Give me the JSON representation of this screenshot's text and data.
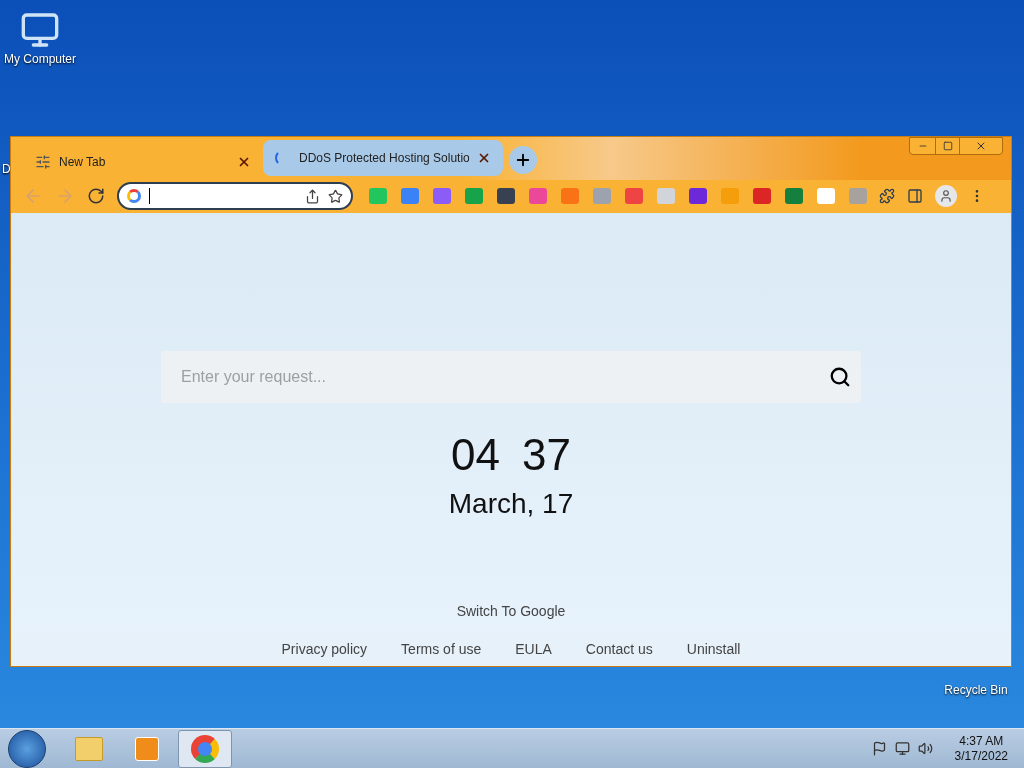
{
  "desktop_icons": [
    {
      "kind": "computer",
      "label": "My Computer"
    },
    {
      "kind": "hidden",
      "label": "D"
    },
    {
      "kind": "bin",
      "label": "Recycle Bin"
    }
  ],
  "tabs": [
    {
      "title": "New Tab",
      "selected": true
    },
    {
      "title": "DDoS Protected Hosting Solutio",
      "selected": false
    }
  ],
  "search": {
    "placeholder": "Enter your request..."
  },
  "clock": {
    "hours": "04",
    "minutes": "37",
    "date": "March, 17"
  },
  "switch_link": "Switch To Google",
  "footer_links": [
    "Privacy policy",
    "Terms of use",
    "EULA",
    "Contact us",
    "Uninstall"
  ],
  "taskbar": {
    "items": [
      {
        "kind": "folder",
        "selected": false
      },
      {
        "kind": "media",
        "selected": false
      },
      {
        "kind": "chrome",
        "selected": true
      }
    ],
    "time": "4:37 AM",
    "date": "3/17/2022"
  }
}
